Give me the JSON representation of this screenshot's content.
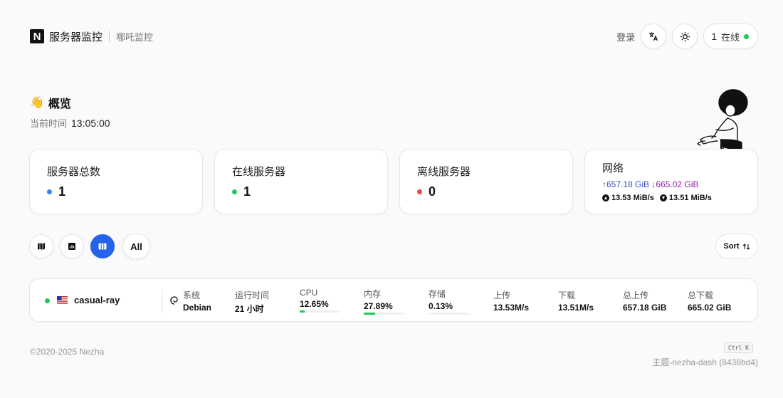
{
  "header": {
    "brand": "服务器监控",
    "subtitle": "哪吒监控",
    "login": "登录",
    "online_count": "1",
    "online_label": "在线"
  },
  "overview": {
    "emoji": "👋",
    "title": "概览",
    "time_label": "当前时间",
    "time_value": "13:05:00"
  },
  "stats": {
    "total": {
      "label": "服务器总数",
      "value": "1",
      "color": "#3b82f6"
    },
    "online": {
      "label": "在线服务器",
      "value": "1",
      "color": "#22c55e"
    },
    "offline": {
      "label": "离线服务器",
      "value": "0",
      "color": "#ef4444"
    },
    "network": {
      "label": "网络",
      "upload_total": "↑657.18 GiB",
      "download_total": "↓665.02 GiB",
      "upload_speed": "13.53 MiB/s",
      "download_speed": "13.51 MiB/s"
    }
  },
  "toolbar": {
    "all_label": "All",
    "sort_label": "Sort"
  },
  "server": {
    "name": "casual-ray",
    "os_label": "系统",
    "os_value": "Debian",
    "uptime_label": "运行时间",
    "uptime_value": "21 小时",
    "cpu_label": "CPU",
    "cpu_value": "12.65%",
    "cpu_fraction": 0.1265,
    "mem_label": "内存",
    "mem_value": "27.89%",
    "mem_fraction": 0.2789,
    "disk_label": "存储",
    "disk_value": "0.13%",
    "disk_fraction": 0.0013,
    "up_label": "上传",
    "up_value": "13.53M/s",
    "down_label": "下载",
    "down_value": "13.51M/s",
    "total_up_label": "总上传",
    "total_up_value": "657.18 GiB",
    "total_down_label": "总下载",
    "total_down_value": "665.02 GiB"
  },
  "footer": {
    "copyright": "©2020-2025 Nezha",
    "shortcut": "Ctrl K",
    "theme": "主题-nezha-dash (8438bd4)"
  }
}
